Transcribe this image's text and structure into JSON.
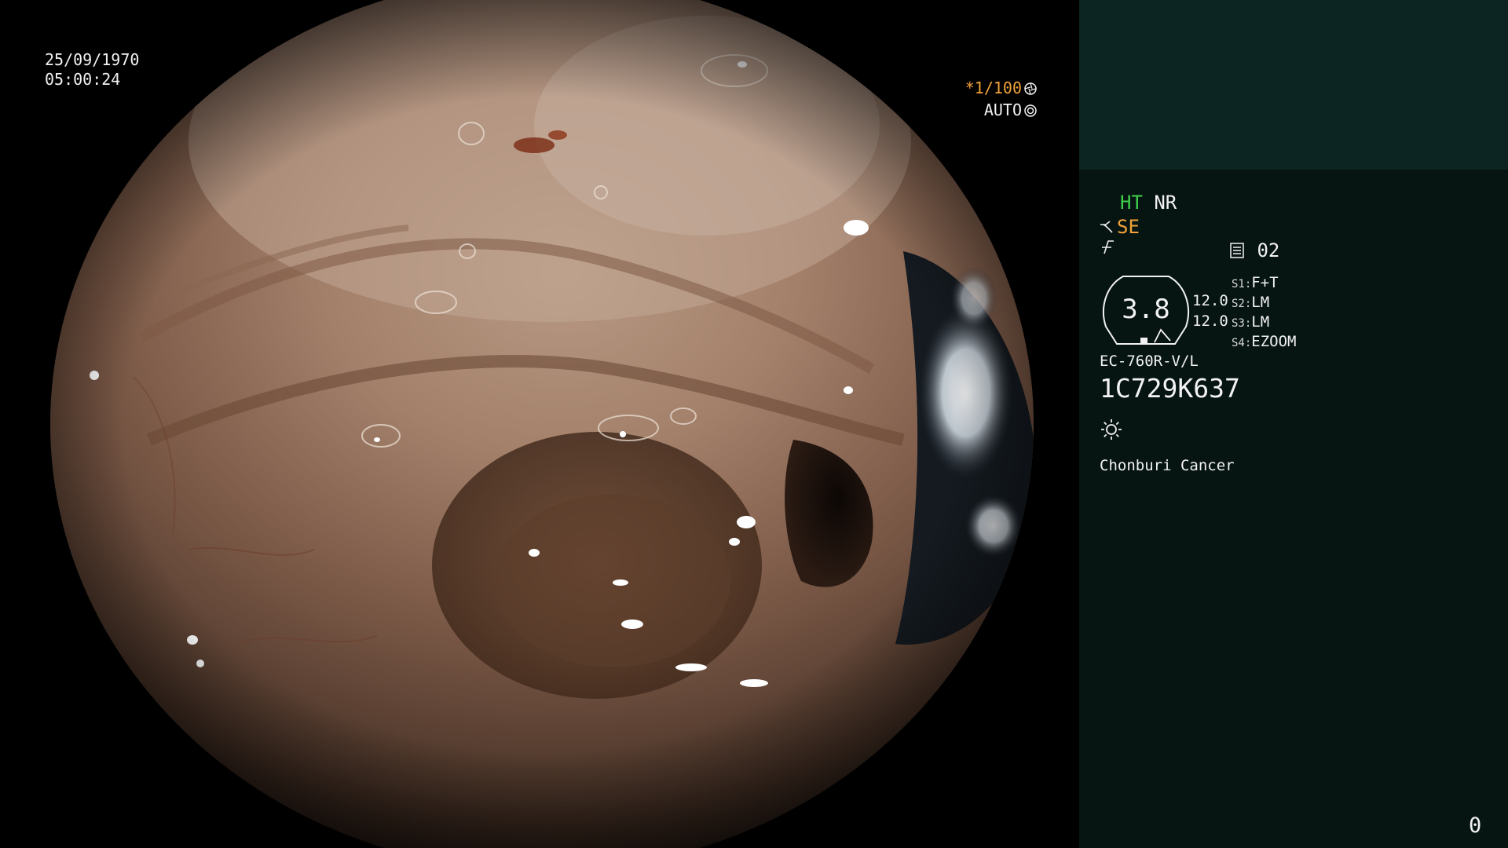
{
  "view": {
    "date": "25/09/1970",
    "time": "05:00:24",
    "shutter": "*1/100",
    "iris_mode": "AUTO",
    "shutter_icon": "aperture-icon",
    "iris_icon": "iris-icon"
  },
  "panel": {
    "mode_primary": "HT",
    "mode_secondary": "NR",
    "enhancement": "SE",
    "enhancement_icon": "contrast-curve-icon",
    "sharpness_icon": "sharpness-icon",
    "record_icon": "memory-card-icon",
    "record_number": "02",
    "gauge_value": "3.8",
    "ratio_top": "12.0",
    "ratio_bottom": "12.0",
    "switches": [
      {
        "key": "S1:",
        "value": "F+T"
      },
      {
        "key": "S2:",
        "value": "LM"
      },
      {
        "key": "S3:",
        "value": "LM"
      },
      {
        "key": "S4:",
        "value": "EZOOM"
      }
    ],
    "scope_model": "EC-760R-V/L",
    "scope_serial": "1C729K637",
    "light_icon": "light-source-icon",
    "hospital": "Chonburi Cancer",
    "counter": "0"
  },
  "colors": {
    "panel_bg": "#061512",
    "panel_top_bg": "#0c2422",
    "accent_orange": "#f2a23a",
    "accent_green": "#3fd14a",
    "text": "#f2f2f2"
  }
}
